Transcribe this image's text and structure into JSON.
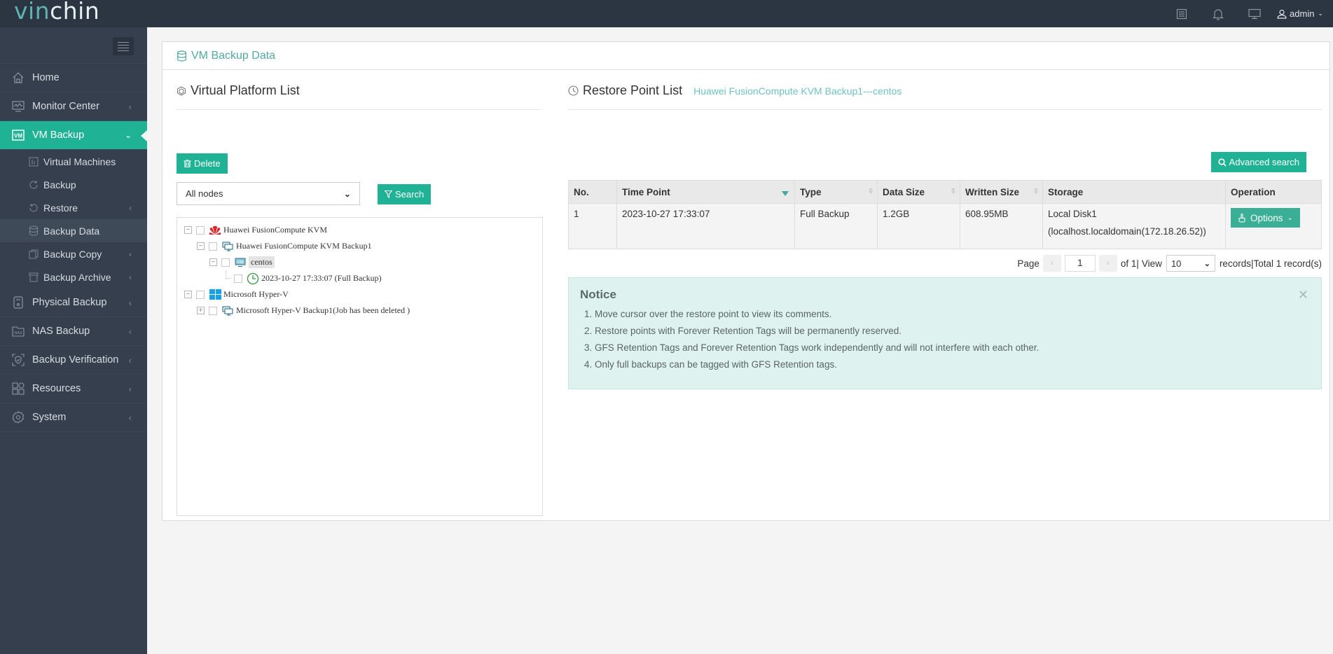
{
  "app": {
    "logo_part1": "vin",
    "logo_part2": "chin"
  },
  "topbar": {
    "icons": [
      "task-list-icon",
      "bell-icon",
      "monitor-icon"
    ],
    "user": "admin"
  },
  "sidebar": {
    "items": [
      {
        "label": "Home",
        "icon": "home-icon",
        "arrow": false
      },
      {
        "label": "Monitor Center",
        "icon": "monitor-chart-icon",
        "arrow": true
      },
      {
        "label": "VM Backup",
        "icon": "vm-icon",
        "arrow": true,
        "active": true
      },
      {
        "label": "Physical Backup",
        "icon": "physical-server-icon",
        "arrow": true
      },
      {
        "label": "NAS Backup",
        "icon": "nas-icon",
        "arrow": true
      },
      {
        "label": "Backup Verification",
        "icon": "shield-check-icon",
        "arrow": true
      },
      {
        "label": "Resources",
        "icon": "resources-grid-icon",
        "arrow": true
      },
      {
        "label": "System",
        "icon": "gear-icon",
        "arrow": true
      }
    ],
    "vm_sub": [
      {
        "label": "Virtual Machines",
        "icon": "vm-list-icon",
        "arrow": false
      },
      {
        "label": "Backup",
        "icon": "backup-refresh-icon",
        "arrow": false
      },
      {
        "label": "Restore",
        "icon": "restore-icon",
        "arrow": true
      },
      {
        "label": "Backup Data",
        "icon": "database-icon",
        "arrow": false,
        "active": true
      },
      {
        "label": "Backup Copy",
        "icon": "copy-icon",
        "arrow": true
      },
      {
        "label": "Backup Archive",
        "icon": "archive-icon",
        "arrow": true
      }
    ]
  },
  "main": {
    "title": "VM Backup Data",
    "left": {
      "title": "Virtual Platform List",
      "delete_label": "Delete",
      "nodes_select": "All nodes",
      "search_label": "Search",
      "tree": [
        {
          "label": "Huawei FusionCompute KVM",
          "level": 0,
          "switch": "minus",
          "icon": "huawei-icon"
        },
        {
          "label": "Huawei FusionCompute KVM Backup1",
          "level": 1,
          "switch": "minus",
          "icon": "backup-job-icon"
        },
        {
          "label": "centos",
          "level": 2,
          "switch": "minus",
          "icon": "vm-icon",
          "selected": true
        },
        {
          "label": "2023-10-27 17:33:07 (Full  Backup)",
          "level": 3,
          "switch": "none",
          "icon": "clock-icon"
        },
        {
          "label": "Microsoft Hyper-V",
          "level": 0,
          "switch": "minus",
          "icon": "windows-icon"
        },
        {
          "label": "Microsoft Hyper-V Backup1(Job has been deleted )",
          "level": 1,
          "switch": "plus",
          "icon": "backup-job-icon"
        }
      ]
    },
    "right": {
      "title": "Restore Point List",
      "subtitle": "Huawei FusionCompute KVM Backup1---centos",
      "advanced_search_label": "Advanced search",
      "columns": [
        "No.",
        "Time Point",
        "Type",
        "Data Size",
        "Written Size",
        "Storage",
        "Operation"
      ],
      "rows": [
        {
          "no": "1",
          "time": "2023-10-27 17:33:07",
          "type": "Full Backup",
          "data_size": "1.2GB",
          "written_size": "608.95MB",
          "storage_line1": "Local Disk1",
          "storage_line2": "(localhost.localdomain(172.18.26.52))",
          "operation": "Options"
        }
      ],
      "pager": {
        "page_label": "Page",
        "page": "1",
        "of_label": "of 1|",
        "view_label": "View",
        "per_page": "10",
        "records_label": "records|Total 1 record(s)"
      },
      "notice": {
        "title": "Notice",
        "items": [
          "1. Move cursor over the restore point to view its comments.",
          "2. Restore points with Forever Retention Tags will be permanently reserved.",
          "3. GFS Retention Tags and Forever Retention Tags work independently and will not interfere with each other.",
          "4. Only full backups can be tagged with GFS Retention tags."
        ]
      }
    }
  },
  "colors": {
    "accent": "#1fb294",
    "sidebar_bg": "#353f4d",
    "topbar_bg": "#2c3542",
    "notice_bg": "#def3ef"
  }
}
